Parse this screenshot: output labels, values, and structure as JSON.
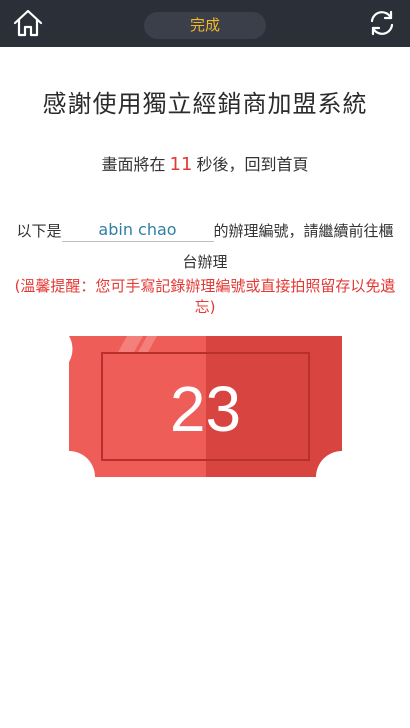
{
  "topbar": {
    "home_icon": "home-icon",
    "status": "完成",
    "refresh_icon": "refresh-icon"
  },
  "main": {
    "title": "感謝使用獨立經銷商加盟系統",
    "countdown_prefix": "畫面將在",
    "countdown_seconds": "11",
    "countdown_suffix": "秒後，回到首頁",
    "info_prefix": "以下是",
    "user_name": "abin chao",
    "info_suffix": "的辦理編號，請繼續前往櫃台辦理",
    "reminder": "(溫馨提醒：您可手寫記錄辦理編號或直接拍照留存以免遺忘)",
    "ticket_number": "23"
  },
  "colors": {
    "topbar": "#2b2f38",
    "accent": "#f2b92a",
    "alert": "#e53935",
    "ticket_light": "#ee5d57",
    "ticket_dark": "#d84540"
  }
}
